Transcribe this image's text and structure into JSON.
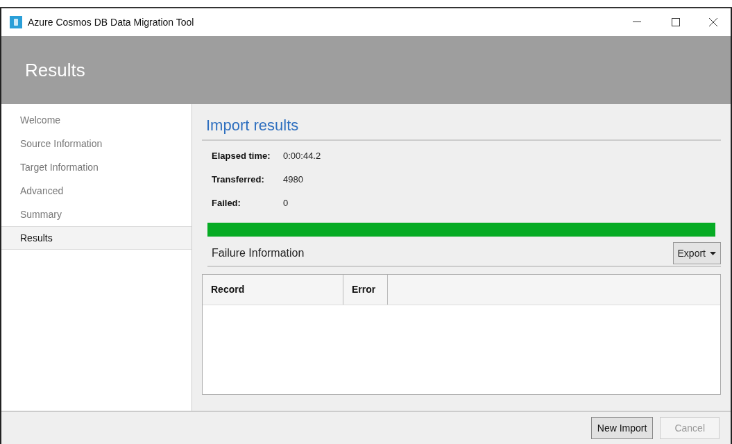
{
  "window": {
    "title": "Azure Cosmos DB Data Migration Tool"
  },
  "header": {
    "title": "Results"
  },
  "sidebar": {
    "items": [
      {
        "label": "Welcome",
        "selected": false
      },
      {
        "label": "Source Information",
        "selected": false
      },
      {
        "label": "Target Information",
        "selected": false
      },
      {
        "label": "Advanced",
        "selected": false
      },
      {
        "label": "Summary",
        "selected": false
      },
      {
        "label": "Results",
        "selected": true
      }
    ]
  },
  "main": {
    "title": "Import results",
    "stats": [
      {
        "label": "Elapsed time:",
        "value": "0:00:44.2"
      },
      {
        "label": "Transferred:",
        "value": "4980"
      },
      {
        "label": "Failed:",
        "value": "0"
      }
    ],
    "progress": {
      "level": 1
    },
    "failure": {
      "title": "Failure Information",
      "export_button": "Export",
      "columns": [
        "Record",
        "Error"
      ]
    }
  },
  "footer": {
    "buttons": [
      {
        "label": "New Import",
        "disabled": false
      },
      {
        "label": "Cancel",
        "disabled": true
      }
    ]
  }
}
